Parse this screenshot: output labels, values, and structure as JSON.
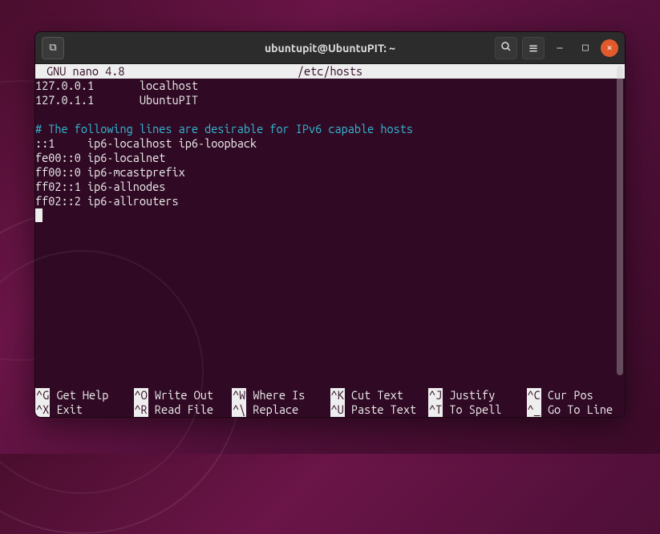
{
  "window": {
    "title": "ubuntupit@UbuntuPIT: ~"
  },
  "nano": {
    "header_title": "GNU nano 4.8",
    "header_file": "/etc/hosts",
    "lines": [
      {
        "text": "127.0.0.1       localhost",
        "cls": ""
      },
      {
        "text": "127.0.1.1       UbuntuPIT",
        "cls": ""
      },
      {
        "text": "",
        "cls": ""
      },
      {
        "text": "# The following lines are desirable for IPv6 capable hosts",
        "cls": "comment"
      },
      {
        "text": "::1     ip6-localhost ip6-loopback",
        "cls": ""
      },
      {
        "text": "fe00::0 ip6-localnet",
        "cls": ""
      },
      {
        "text": "ff00::0 ip6-mcastprefix",
        "cls": ""
      },
      {
        "text": "ff02::1 ip6-allnodes",
        "cls": ""
      },
      {
        "text": "ff02::2 ip6-allrouters",
        "cls": ""
      }
    ],
    "footer": [
      {
        "key": "^G",
        "label": "Get Help"
      },
      {
        "key": "^O",
        "label": "Write Out"
      },
      {
        "key": "^W",
        "label": "Where Is"
      },
      {
        "key": "^K",
        "label": "Cut Text"
      },
      {
        "key": "^J",
        "label": "Justify"
      },
      {
        "key": "^C",
        "label": "Cur Pos"
      },
      {
        "key": "^X",
        "label": "Exit"
      },
      {
        "key": "^R",
        "label": "Read File"
      },
      {
        "key": "^\\",
        "label": "Replace"
      },
      {
        "key": "^U",
        "label": "Paste Text"
      },
      {
        "key": "^T",
        "label": "To Spell"
      },
      {
        "key": "^_",
        "label": "Go To Line"
      }
    ]
  },
  "icons": {
    "newtab": "⧉",
    "search": "🔍",
    "menu": "≡",
    "min": "—",
    "max": "□",
    "close": "✕"
  }
}
